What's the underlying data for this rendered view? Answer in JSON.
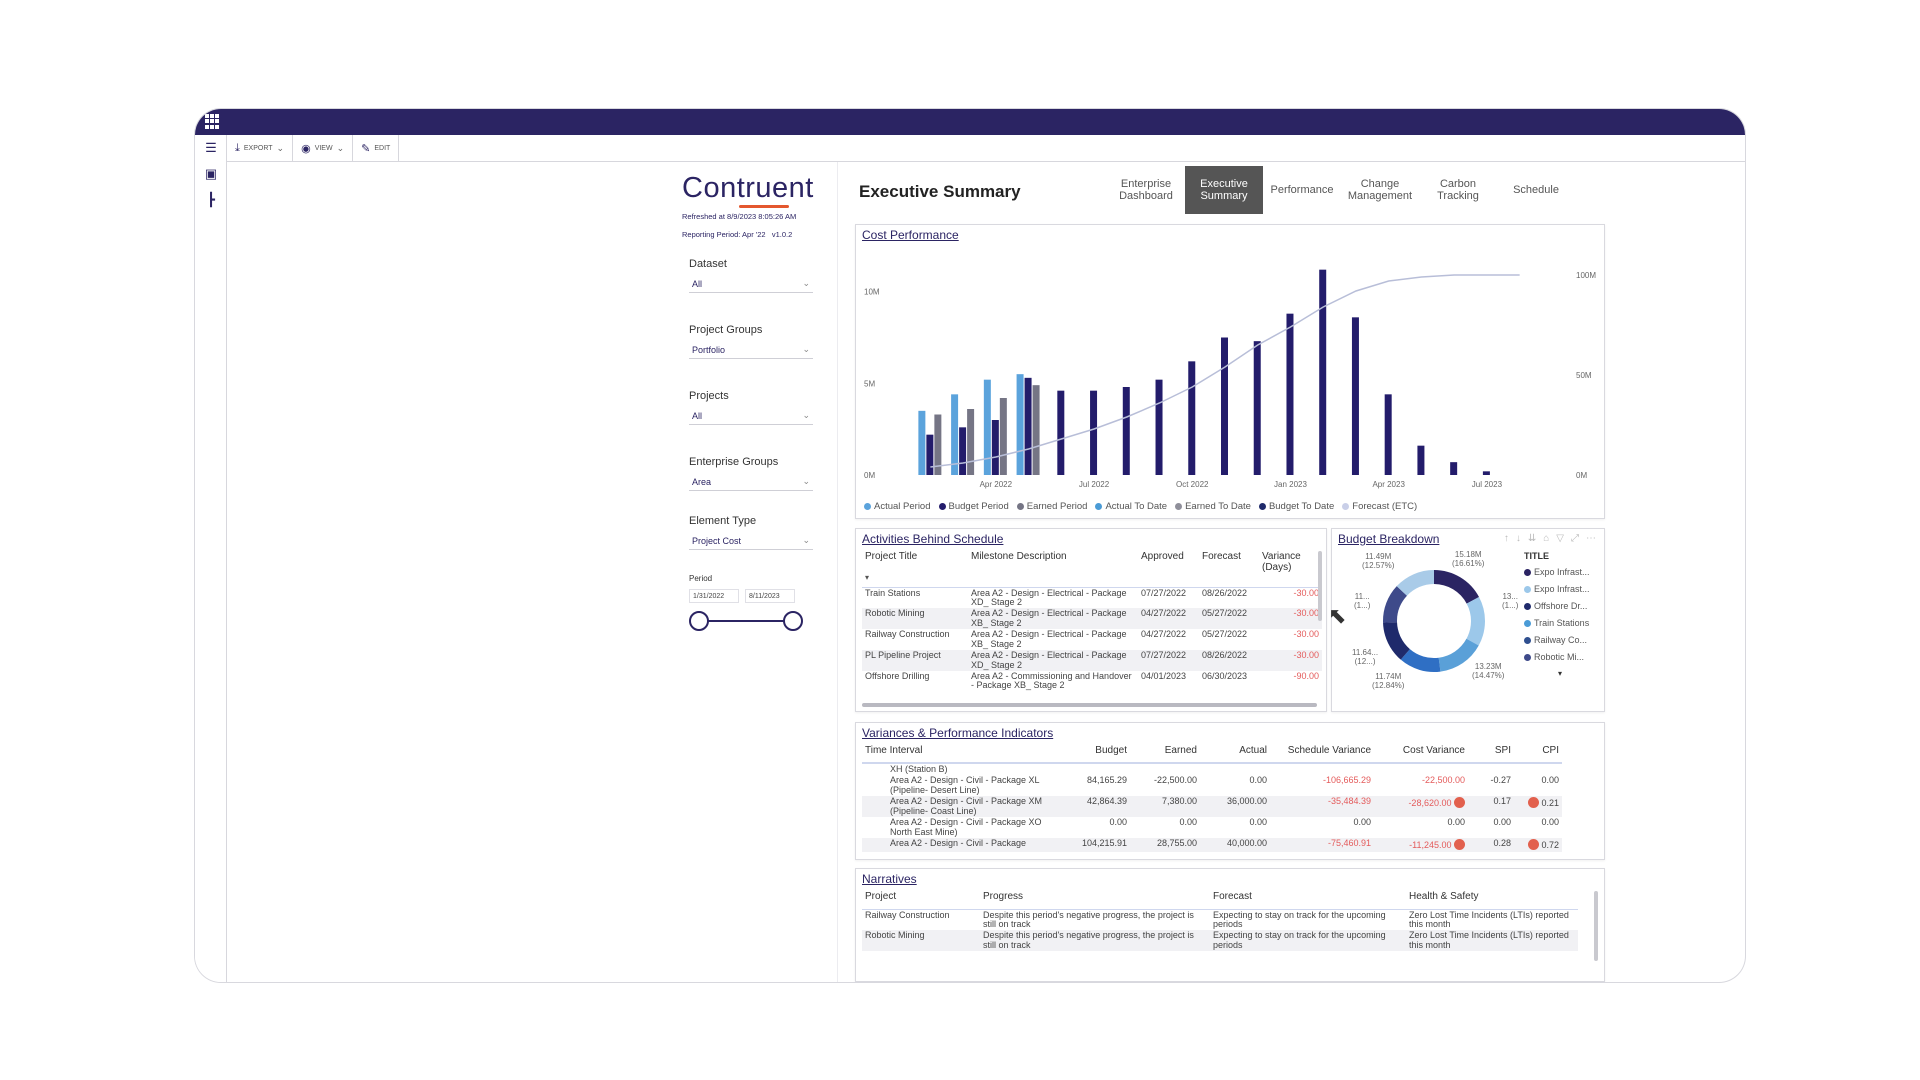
{
  "toolbar": {
    "export": "EXPORT",
    "view": "VIEW",
    "edit": "EDIT"
  },
  "brand": {
    "logo": "Contruent",
    "refreshed": "Refreshed at 8/9/2023 8:05:26 AM",
    "reporting_period": "Reporting Period: Apr '22",
    "version": "v1.0.2"
  },
  "filters": {
    "dataset": {
      "label": "Dataset",
      "value": "All"
    },
    "project_groups": {
      "label": "Project Groups",
      "value": "Portfolio"
    },
    "projects": {
      "label": "Projects",
      "value": "All"
    },
    "enterprise_groups": {
      "label": "Enterprise Groups",
      "value": "Area"
    },
    "element_type": {
      "label": "Element Type",
      "value": "Project Cost"
    },
    "period": {
      "label": "Period",
      "start": "1/31/2022",
      "end": "8/11/2023"
    }
  },
  "page_title": "Executive Summary",
  "nav": [
    {
      "label": "Enterprise\nDashboard"
    },
    {
      "label": "Executive\nSummary"
    },
    {
      "label": "Performance"
    },
    {
      "label": "Change\nManagement"
    },
    {
      "label": "Carbon\nTracking"
    },
    {
      "label": "Schedule"
    }
  ],
  "cost_performance": {
    "title": "Cost Performance",
    "legend": [
      "Actual Period",
      "Budget Period",
      "Earned Period",
      "Actual To Date",
      "Earned To Date",
      "Budget To Date",
      "Forecast (ETC)"
    ],
    "colors": {
      "actual_period": "#5ba3dc",
      "budget_period": "#231c6b",
      "earned_period": "#757585",
      "actual_to_date": "#4a9bd6",
      "earned_to_date": "#8f8f9a",
      "budget_to_date": "#1f2a6b",
      "forecast": "#c9cfe8"
    }
  },
  "chart_data": {
    "type": "bar",
    "x_ticks": [
      "Apr 2022",
      "Jul 2022",
      "Oct 2022",
      "Jan 2023",
      "Apr 2023",
      "Jul 2023"
    ],
    "y_left_ticks": [
      "0M",
      "5M",
      "10M"
    ],
    "y_right_ticks": [
      "0M",
      "50M",
      "100M"
    ],
    "ylim_left": [
      0,
      12
    ],
    "ylim_right": [
      0,
      110
    ],
    "months": [
      "Feb 2022",
      "Mar 2022",
      "Apr 2022",
      "May 2022",
      "Jun 2022",
      "Jul 2022",
      "Aug 2022",
      "Sep 2022",
      "Oct 2022",
      "Nov 2022",
      "Dec 2022",
      "Jan 2023",
      "Feb 2023",
      "Mar 2023",
      "Apr 2023",
      "May 2023",
      "Jun 2023",
      "Jul 2023",
      "Aug 2023"
    ],
    "series": [
      {
        "name": "Actual Period",
        "values": [
          3.5,
          4.4,
          5.2,
          5.5,
          null,
          null,
          null,
          null,
          null,
          null,
          null,
          null,
          null,
          null,
          null,
          null,
          null,
          null,
          null
        ]
      },
      {
        "name": "Budget Period",
        "values": [
          2.2,
          2.6,
          3.0,
          5.3,
          4.6,
          4.6,
          4.8,
          5.2,
          6.2,
          7.5,
          7.3,
          8.8,
          11.2,
          8.6,
          4.4,
          1.6,
          0.7,
          0.2,
          null
        ]
      },
      {
        "name": "Earned Period",
        "values": [
          3.3,
          3.6,
          4.2,
          4.9,
          null,
          null,
          null,
          null,
          null,
          null,
          null,
          null,
          null,
          null,
          null,
          null,
          null,
          null,
          null
        ]
      },
      {
        "name": "Forecast (ETC)",
        "values": [
          4,
          6,
          9,
          13,
          18,
          23,
          29,
          36,
          44,
          54,
          65,
          74,
          84,
          92,
          97,
          99,
          100,
          100,
          100
        ]
      }
    ]
  },
  "activities": {
    "title": "Activities Behind Schedule",
    "columns": [
      "Project Title",
      "Milestone Description",
      "Approved",
      "Forecast",
      "Variance\n(Days)"
    ],
    "rows": [
      {
        "project": "Train Stations",
        "milestone": "Area A2 - Design - Electrical - Package XD_ Stage 2",
        "approved": "07/27/2022",
        "forecast": "08/26/2022",
        "variance": "-30.00"
      },
      {
        "project": "Robotic Mining",
        "milestone": "Area A2 - Design - Electrical - Package XB_ Stage 2",
        "approved": "04/27/2022",
        "forecast": "05/27/2022",
        "variance": "-30.00"
      },
      {
        "project": "Railway Construction",
        "milestone": "Area A2 - Design - Electrical - Package XB_ Stage 2",
        "approved": "04/27/2022",
        "forecast": "05/27/2022",
        "variance": "-30.00"
      },
      {
        "project": "PL Pipeline Project",
        "milestone": "Area A2 - Design - Electrical - Package XD_ Stage 2",
        "approved": "07/27/2022",
        "forecast": "08/26/2022",
        "variance": "-30.00"
      },
      {
        "project": "Offshore Drilling",
        "milestone": "Area A2 - Commissioning and Handover - Package XB_ Stage 2",
        "approved": "04/01/2023",
        "forecast": "06/30/2023",
        "variance": "-90.00"
      }
    ]
  },
  "budget_breakdown": {
    "title": "Budget Breakdown",
    "legend_title": "TITLE",
    "legend": [
      "Expo Infrast...",
      "Expo Infrast...",
      "Offshore Dr...",
      "Train Stations",
      "Railway Co...",
      "Robotic Mi..."
    ],
    "slices": [
      {
        "value": 15.18,
        "color": "#2b2463"
      },
      {
        "value": 13.9,
        "color": "#9cc8ea"
      },
      {
        "value": 13.23,
        "color": "#5aa0d8"
      },
      {
        "value": 11.74,
        "color": "#2f6fc4"
      },
      {
        "value": 11.64,
        "color": "#1f2a6b"
      },
      {
        "value": 11.0,
        "color": "#3e4a8a"
      },
      {
        "value": 11.49,
        "color": "#a9cbe8"
      }
    ],
    "labels": {
      "top_right": "15.18M\n(16.61%)",
      "top_left": "11.49M\n(12.57%)",
      "left": "11...\n(1...)",
      "left_low": "11.64...\n(12...)",
      "bottom": "11.74M\n(12.84%)",
      "bottom_right": "13.23M\n(14.47%)",
      "right": "13...\n(1...)"
    }
  },
  "variances": {
    "title": "Variances & Performance Indicators",
    "columns": [
      "Time Interval",
      "Budget",
      "Earned",
      "Actual",
      "Schedule Variance",
      "Cost Variance",
      "SPI",
      "CPI"
    ],
    "rows": [
      {
        "interval": "XH (Station B)",
        "budget": "",
        "earned": "",
        "actual": "",
        "sv": "",
        "cv": "",
        "spi": "",
        "cpi": "",
        "dot_cv": false,
        "dot_spi": false
      },
      {
        "interval": "Area A2 - Design - Civil - Package XL (Pipeline- Desert Line)",
        "budget": "84,165.29",
        "earned": "-22,500.00",
        "actual": "0.00",
        "sv": "-106,665.29",
        "cv": "-22,500.00",
        "spi": "-0.27",
        "cpi": "0.00",
        "dot_cv": false,
        "dot_spi": false
      },
      {
        "interval": "Area A2 - Design - Civil - Package XM (Pipeline- Coast Line)",
        "budget": "42,864.39",
        "earned": "7,380.00",
        "actual": "36,000.00",
        "sv": "-35,484.39",
        "cv": "-28,620.00",
        "spi": "0.17",
        "cpi": "0.21",
        "dot_cv": true,
        "dot_spi": true
      },
      {
        "interval": "Area A2 - Design - Civil - Package XO North East Mine)",
        "budget": "0.00",
        "earned": "0.00",
        "actual": "0.00",
        "sv": "0.00",
        "cv": "0.00",
        "spi": "0.00",
        "cpi": "0.00",
        "dot_cv": false,
        "dot_spi": false
      },
      {
        "interval": "Area A2 - Design - Civil - Package",
        "budget": "104,215.91",
        "earned": "28,755.00",
        "actual": "40,000.00",
        "sv": "-75,460.91",
        "cv": "-11,245.00",
        "spi": "0.28",
        "cpi": "0.72",
        "dot_cv": true,
        "dot_spi": true
      }
    ]
  },
  "narratives": {
    "title": "Narratives",
    "columns": [
      "Project",
      "Progress",
      "Forecast",
      "Health & Safety"
    ],
    "rows": [
      {
        "project": "Railway Construction",
        "progress": "Despite this period's negative progress, the project is still on track",
        "forecast": "Expecting to stay on track for the upcoming periods",
        "hs": "Zero Lost Time Incidents (LTIs) reported this month"
      },
      {
        "project": "Robotic Mining",
        "progress": "Despite this period's negative progress, the project is still on track",
        "forecast": "Expecting to stay on track for the upcoming periods",
        "hs": "Zero Lost Time Incidents (LTIs) reported this month"
      }
    ]
  }
}
